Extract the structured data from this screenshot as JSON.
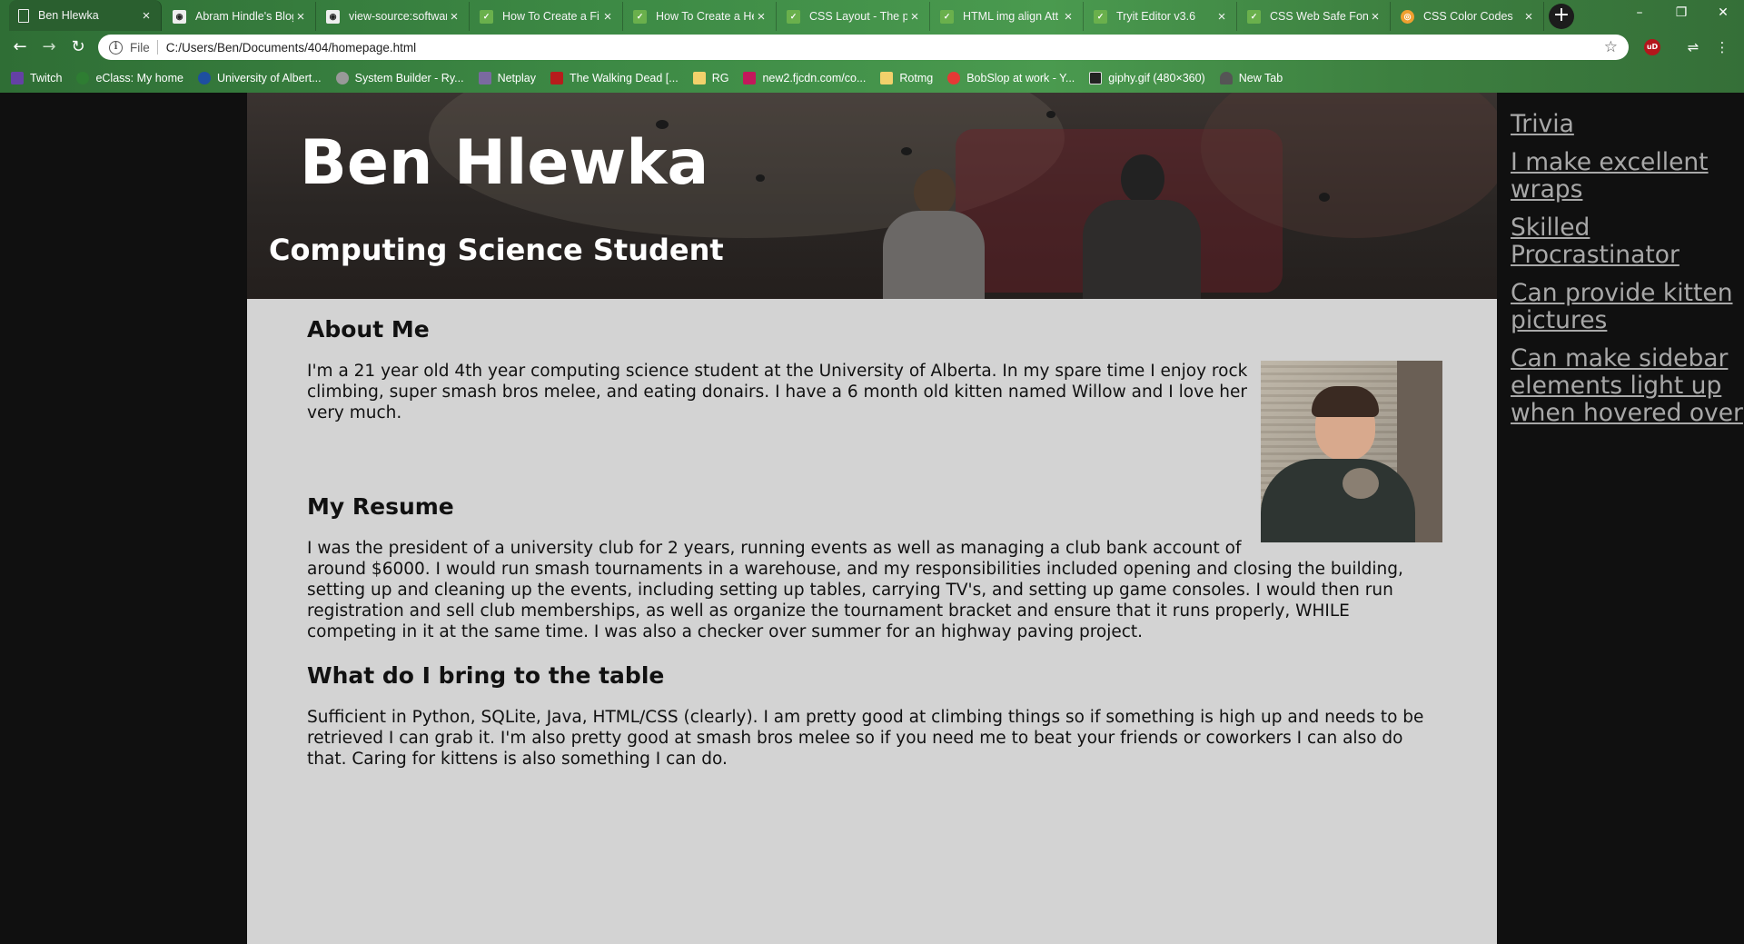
{
  "browser": {
    "tabs": [
      {
        "title": "Ben Hlewka",
        "favicon": "doc-icon",
        "active": true
      },
      {
        "title": "Abram Hindle's Blog",
        "favicon": "github-icon"
      },
      {
        "title": "view-source:softwar",
        "favicon": "github-icon"
      },
      {
        "title": "How To Create a Fi",
        "favicon": "w3schools-icon"
      },
      {
        "title": "How To Create a He",
        "favicon": "w3schools-icon"
      },
      {
        "title": "CSS Layout - The p",
        "favicon": "w3schools-icon"
      },
      {
        "title": "HTML img align Att",
        "favicon": "w3schools-icon"
      },
      {
        "title": "Tryit Editor v3.6",
        "favicon": "w3schools-icon"
      },
      {
        "title": "CSS Web Safe Fonts",
        "favicon": "w3schools-icon"
      },
      {
        "title": "CSS Color Codes",
        "favicon": "color-codes-icon"
      }
    ],
    "close_glyph": "×",
    "new_tab_glyph": "+",
    "window_controls": {
      "minimize": "–",
      "maximize": "❐",
      "close": "✕"
    },
    "nav": {
      "back": "←",
      "forward": "→",
      "reload": "↻"
    },
    "address": {
      "scheme_label": "File",
      "url": "C:/Users/Ben/Documents/404/homepage.html",
      "info_glyph": "i",
      "star_glyph": "☆"
    },
    "extensions": {
      "ublock_label": "uD",
      "ext2_glyph": "⇌",
      "menu_glyph": "⋮"
    },
    "bookmarks": [
      {
        "label": "Twitch",
        "color": "#6441a5"
      },
      {
        "label": "eClass: My home",
        "color": "#2e7d32"
      },
      {
        "label": "University of Albert...",
        "color": "#1e4fa0"
      },
      {
        "label": "System Builder - Ry...",
        "color": "#999999"
      },
      {
        "label": "Netplay",
        "color": "#7a6aa0"
      },
      {
        "label": "The Walking Dead [...",
        "color": "#b71c1c"
      },
      {
        "label": "RG",
        "color": "#f2d16b"
      },
      {
        "label": "new2.fjcdn.com/co...",
        "color": "#c2185b"
      },
      {
        "label": "Rotmg",
        "color": "#f2d16b"
      },
      {
        "label": "BobSlop at work - Y...",
        "color": "#e53935"
      },
      {
        "label": "giphy.gif (480×360)",
        "color": "#222222"
      },
      {
        "label": "New Tab",
        "color": "#555555"
      }
    ]
  },
  "page": {
    "header": {
      "name": "Ben Hlewka",
      "subtitle": "Computing Science Student"
    },
    "sections": {
      "about": {
        "heading": "About Me",
        "body": "I'm a 21 year old 4th year computing science student at the University of Alberta. In my spare time I enjoy rock climbing, super smash bros melee, and eating donairs. I have a 6 month old kitten named Willow and I love her very much."
      },
      "resume": {
        "heading": "My Resume",
        "body": "I was the president of a university club for 2 years, running events as well as managing a club bank account of around $6000. I would run smash tournaments in a warehouse, and my responsibilities included opening and closing the building, setting up and cleaning up the events, including setting up tables, carrying TV's, and setting up game consoles. I would then run registration and sell club memberships, as well as organize the tournament bracket and ensure that it runs properly, WHILE competing in it at the same time. I was also a checker over summer for an highway paving project."
      },
      "bring": {
        "heading": "What do I bring to the table",
        "body": "Sufficient in Python, SQLite, Java, HTML/CSS (clearly). I am pretty good at climbing things so if something is high up and needs to be retrieved I can grab it. I'm also pretty good at smash bros melee so if you need me to beat your friends or coworkers I can also do that. Caring for kittens is also something I can do."
      }
    },
    "sidebar": {
      "links": [
        {
          "label": "Trivia"
        },
        {
          "label": "I make excellent wraps"
        },
        {
          "label": "Skilled Procrastinator"
        },
        {
          "label": "Can provide kitten pictures"
        },
        {
          "label": "Can make sidebar elements light up when hovered over"
        }
      ]
    }
  },
  "colors": {
    "chrome_green": "#3d8a45",
    "page_background": "#101010",
    "content_background": "#d3d3d3",
    "sidebar_link": "#a8a8a8"
  }
}
